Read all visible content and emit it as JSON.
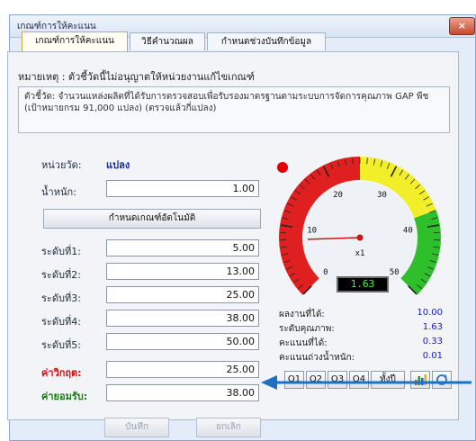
{
  "window": {
    "title": "เกณฑ์การให้คะแนน",
    "close_label": "×"
  },
  "tabs": [
    {
      "label": "เกณฑ์การให้คะแนน",
      "active": true
    },
    {
      "label": "วิธีคำนวณผล",
      "active": false
    },
    {
      "label": "กำหนดช่วงบันทึกข้อมูล",
      "active": false
    }
  ],
  "note": "หมายเหตุ : ตัวชี้วัดนี้ไม่อนุญาตให้หน่วยงานแก้ไขเกณฑ์",
  "indicator_desc": "ตัวชี้วัด: จำนวนแหล่งผลิตที่ได้รับการตรวจสอบเพื่อรับรองมาตรฐานตามระบบการจัดการคุณภาพ GAP พืช (เป้าหมายกรม 91,000 แปลง) (ตรวจแล้วกี่แปลง)",
  "form": {
    "unit_label": "หน่วยวัด:",
    "unit_value": "แปลง",
    "weight_label": "น้ำหนัก:",
    "weight_value": "1.00",
    "auto_button": "กำหนดเกณฑ์อัตโนมัติ",
    "levels": [
      {
        "label": "ระดับที่1:",
        "value": "5.00"
      },
      {
        "label": "ระดับที่2:",
        "value": "13.00"
      },
      {
        "label": "ระดับที่3:",
        "value": "25.00"
      },
      {
        "label": "ระดับที่4:",
        "value": "38.00"
      },
      {
        "label": "ระดับที่5:",
        "value": "50.00"
      }
    ],
    "critical_label": "ค่าวิกฤต:",
    "critical_value": "25.00",
    "acceptable_label": "ค่ายอมรับ:",
    "acceptable_value": "38.00",
    "save_button": "บันทึก",
    "cancel_button": "ยกเลิก"
  },
  "gauge": {
    "min": 0,
    "max": 50,
    "needle_value": 8,
    "tick_labels": [
      "0",
      "10",
      "20",
      "30",
      "40",
      "50"
    ],
    "multiplier_label": "x1",
    "display_value": "1.63",
    "zone_colors": {
      "red": "#e02020",
      "yellow": "#f2ee2a",
      "green": "#2fbf2a"
    },
    "status_dot_color": "#e00000"
  },
  "stats": [
    {
      "label": "ผลงานที่ได้:",
      "value": "10.00"
    },
    {
      "label": "ระดับคุณภาพ:",
      "value": "1.63"
    },
    {
      "label": "คะแนนที่ได้:",
      "value": "0.33"
    },
    {
      "label": "คะแนนถ่วงน้ำหนัก:",
      "value": "0.01"
    }
  ],
  "quarter_buttons": [
    "Q1",
    "Q2",
    "Q3",
    "Q4",
    "ทั้งปี"
  ],
  "icons": {
    "chart": "bar-chart-icon",
    "refresh": "refresh-icon",
    "arrow": "pointer-arrow"
  }
}
